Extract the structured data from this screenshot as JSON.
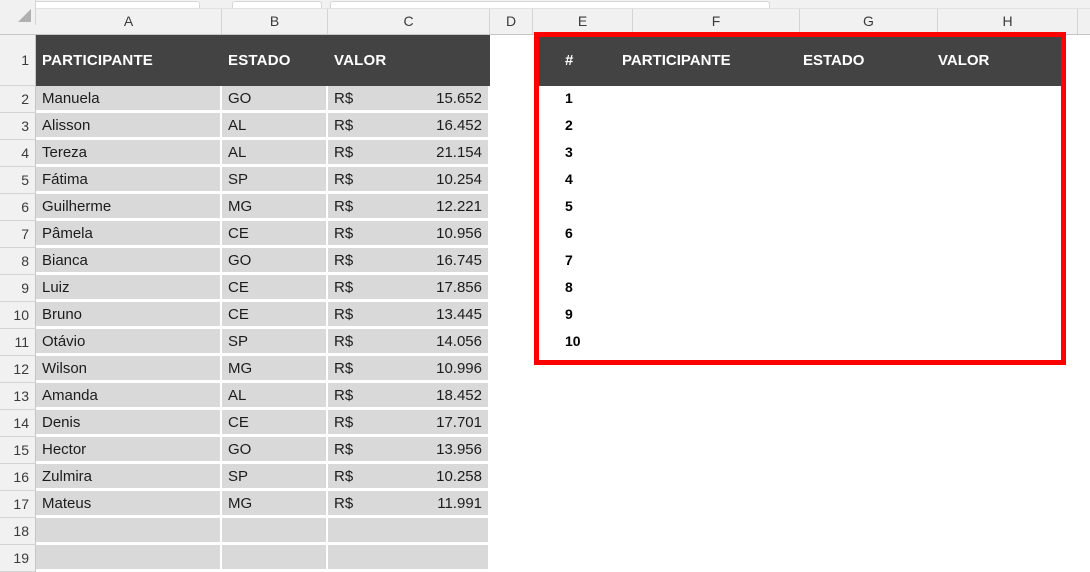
{
  "app": {
    "type": "spreadsheet"
  },
  "grid": {
    "column_headers": [
      "A",
      "B",
      "C",
      "D",
      "E",
      "F",
      "G",
      "H"
    ],
    "row_headers": [
      "1",
      "2",
      "3",
      "4",
      "5",
      "6",
      "7",
      "8",
      "9",
      "10",
      "11",
      "12",
      "13",
      "14",
      "15",
      "16",
      "17",
      "18",
      "19"
    ]
  },
  "source_table": {
    "headers": {
      "participante": "PARTICIPANTE",
      "estado": "ESTADO",
      "valor": "VALOR"
    },
    "currency_symbol": "R$",
    "rows": [
      {
        "participante": "Manuela",
        "estado": "GO",
        "moeda": "R$",
        "valor": "15.652"
      },
      {
        "participante": "Alisson",
        "estado": "AL",
        "moeda": "R$",
        "valor": "16.452"
      },
      {
        "participante": "Tereza",
        "estado": "AL",
        "moeda": "R$",
        "valor": "21.154"
      },
      {
        "participante": "Fátima",
        "estado": "SP",
        "moeda": "R$",
        "valor": "10.254"
      },
      {
        "participante": "Guilherme",
        "estado": "MG",
        "moeda": "R$",
        "valor": "12.221"
      },
      {
        "participante": "Pâmela",
        "estado": "CE",
        "moeda": "R$",
        "valor": "10.956"
      },
      {
        "participante": "Bianca",
        "estado": "GO",
        "moeda": "R$",
        "valor": "16.745"
      },
      {
        "participante": "Luiz",
        "estado": "CE",
        "moeda": "R$",
        "valor": "17.856"
      },
      {
        "participante": "Bruno",
        "estado": "CE",
        "moeda": "R$",
        "valor": "13.445"
      },
      {
        "participante": "Otávio",
        "estado": "SP",
        "moeda": "R$",
        "valor": "14.056"
      },
      {
        "participante": "Wilson",
        "estado": "MG",
        "moeda": "R$",
        "valor": "10.996"
      },
      {
        "participante": "Amanda",
        "estado": "AL",
        "moeda": "R$",
        "valor": "18.452"
      },
      {
        "participante": "Denis",
        "estado": "CE",
        "moeda": "R$",
        "valor": "17.701"
      },
      {
        "participante": "Hector",
        "estado": "GO",
        "moeda": "R$",
        "valor": "13.956"
      },
      {
        "participante": "Zulmira",
        "estado": "SP",
        "moeda": "R$",
        "valor": "10.258"
      },
      {
        "participante": "Mateus",
        "estado": "MG",
        "moeda": "R$",
        "valor": "11.991"
      },
      {
        "participante": "",
        "estado": "",
        "moeda": "",
        "valor": ""
      },
      {
        "participante": "",
        "estado": "",
        "moeda": "",
        "valor": ""
      }
    ]
  },
  "result_table": {
    "highlight_color": "#ff0000",
    "header_bg": "#434343",
    "headers": {
      "rank": "#",
      "participante": "PARTICIPANTE",
      "estado": "ESTADO",
      "valor": "VALOR"
    },
    "rows": [
      {
        "rank": "1",
        "participante": "",
        "estado": "",
        "valor": ""
      },
      {
        "rank": "2",
        "participante": "",
        "estado": "",
        "valor": ""
      },
      {
        "rank": "3",
        "participante": "",
        "estado": "",
        "valor": ""
      },
      {
        "rank": "4",
        "participante": "",
        "estado": "",
        "valor": ""
      },
      {
        "rank": "5",
        "participante": "",
        "estado": "",
        "valor": ""
      },
      {
        "rank": "6",
        "participante": "",
        "estado": "",
        "valor": ""
      },
      {
        "rank": "7",
        "participante": "",
        "estado": "",
        "valor": ""
      },
      {
        "rank": "8",
        "participante": "",
        "estado": "",
        "valor": ""
      },
      {
        "rank": "9",
        "participante": "",
        "estado": "",
        "valor": ""
      },
      {
        "rank": "10",
        "participante": "",
        "estado": "",
        "valor": ""
      }
    ]
  }
}
